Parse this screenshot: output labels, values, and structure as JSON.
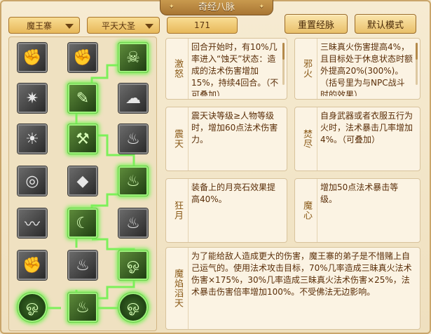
{
  "window": {
    "title": "奇经八脉"
  },
  "toolbar": {
    "sect": "魔王寨",
    "form": "平天大圣",
    "points": "171",
    "reset_label": "重置经脉",
    "default_label": "默认模式"
  },
  "tree": {
    "nodes": [
      {
        "id": "n1",
        "icon": "fist-icon",
        "glyph": "✊",
        "active": false
      },
      {
        "id": "n2",
        "icon": "fist-run-icon",
        "glyph": "✊",
        "active": false
      },
      {
        "id": "n3",
        "icon": "demon-face-icon",
        "glyph": "☠",
        "active": true
      },
      {
        "id": "n4",
        "icon": "star-burst-icon",
        "glyph": "✷",
        "active": false
      },
      {
        "id": "n5",
        "icon": "scroll-icon",
        "glyph": "✎",
        "active": true
      },
      {
        "id": "n6",
        "icon": "cloud-swirl-icon",
        "glyph": "☁",
        "active": false
      },
      {
        "id": "n7",
        "icon": "sun-emblem-icon",
        "glyph": "☀",
        "active": false
      },
      {
        "id": "n8",
        "icon": "hammer-icon",
        "glyph": "⚒",
        "active": true
      },
      {
        "id": "n9",
        "icon": "flame-icon",
        "glyph": "♨",
        "active": false
      },
      {
        "id": "n10",
        "icon": "shield-round-icon",
        "glyph": "◎",
        "active": false
      },
      {
        "id": "n11",
        "icon": "stone-icon",
        "glyph": "◆",
        "active": false
      },
      {
        "id": "n12",
        "icon": "fire-burst-icon",
        "glyph": "♨",
        "active": true
      },
      {
        "id": "n13",
        "icon": "serpent-icon",
        "glyph": "〰",
        "active": false
      },
      {
        "id": "n14",
        "icon": "crescent-moon-icon",
        "glyph": "☾",
        "active": true
      },
      {
        "id": "n15",
        "icon": "blaze-icon",
        "glyph": "♨",
        "active": false
      },
      {
        "id": "n16",
        "icon": "fist-strike-icon",
        "glyph": "✊",
        "active": false
      },
      {
        "id": "n17",
        "icon": "dragon-fire-icon",
        "glyph": "♨",
        "active": false
      },
      {
        "id": "n18",
        "icon": "wave-swirl-icon",
        "glyph": "ஓ",
        "active": true
      },
      {
        "id": "n19",
        "icon": "spiral-orb-icon",
        "glyph": "ஓ",
        "active": true
      },
      {
        "id": "n20",
        "icon": "flame-pillar-icon",
        "glyph": "♨",
        "active": true
      },
      {
        "id": "n21",
        "icon": "spiral-orb-icon",
        "glyph": "ஓ",
        "active": true
      }
    ]
  },
  "skills": [
    {
      "name": "激怒",
      "desc": "回合开始时，有10%几率进入“蚀天”状态：造成的法术伤害增加15%，持续4回合。（不可叠加）"
    },
    {
      "name": "邪火",
      "desc": "三昧真火伤害提高4%，且目标处于休息状态时额外提高20%(300%)。（括号里为与NPC战斗时的效果）"
    },
    {
      "name": "震天",
      "desc": "震天诀等级≥人物等级时，增加60点法术伤害力。"
    },
    {
      "name": "焚尽",
      "desc": "自身武器或者衣服五行为火时，法术暴击几率增加4%。（可叠加）"
    },
    {
      "name": "狂月",
      "desc": "装备上的月亮石效果提高40%。"
    },
    {
      "name": "魔心",
      "desc": "增加50点法术暴击等级。"
    },
    {
      "name": "魔焰滔天",
      "desc": "为了能给敌人造成更大的伤害，魔王寨的弟子是不惜赌上自己运气的。使用法术攻击目标，70%几率造成三昧真火法术伤害×175%，30%几率造成三昧真火法术伤害×25%，法术暴击伤害倍率增加100%。不受佛法无边影响。"
    }
  ],
  "colors": {
    "active_glow": "#7df05a",
    "accent": "#e7b85a",
    "text": "#5a2e08"
  }
}
